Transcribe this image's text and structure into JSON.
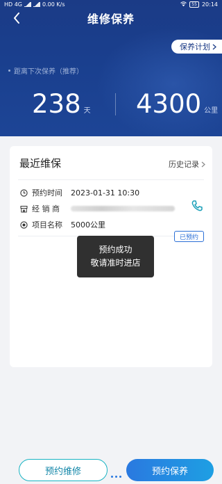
{
  "status_bar": {
    "left_text": "HD 4G",
    "speed": "0.00 K/s",
    "battery": "55",
    "time": "20:14"
  },
  "nav": {
    "title": "维修保养"
  },
  "header": {
    "plan_button": "保养计划",
    "hint": "距离下次保养（推荐）",
    "days_value": "238",
    "days_unit": "天",
    "km_value": "4300",
    "km_unit": "公里"
  },
  "card": {
    "title": "最近维保",
    "history_link": "历史记录",
    "appointment_time_label": "预约时间",
    "appointment_time_value": "2023-01-31 10:30",
    "dealer_label": "经 销 商",
    "item_label": "项目名称",
    "item_value": "5000公里",
    "status_badge": "已预约"
  },
  "toast": {
    "line1": "预约成功",
    "line2": "敬请准时进店"
  },
  "footer": {
    "repair_button": "预约维修",
    "maintenance_button": "预约保养"
  },
  "colors": {
    "header_bg": "#1b3b86",
    "accent": "#2a79e0",
    "teal": "#18b3c2"
  }
}
